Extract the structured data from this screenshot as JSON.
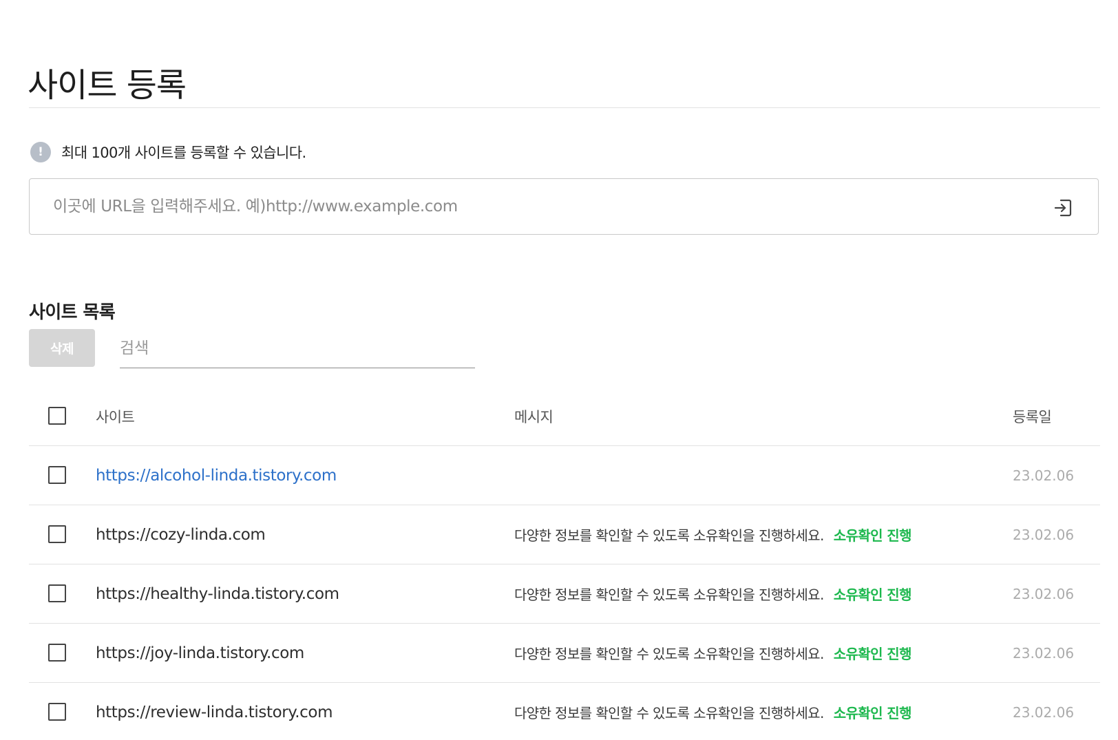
{
  "page": {
    "title": "사이트 등록"
  },
  "notice": {
    "icon": "exclamation-circle-icon",
    "icon_glyph": "!",
    "text": "최대 100개 사이트를 등록할 수 있습니다."
  },
  "url_input": {
    "placeholder": "이곳에 URL을 입력해주세요. 예)http://www.example.com",
    "value": "",
    "submit_icon": "enter-arrow-icon"
  },
  "site_list": {
    "title": "사이트 목록",
    "delete_label": "삭제",
    "search_placeholder": "검색",
    "columns": {
      "site": "사이트",
      "message": "메시지",
      "date": "등록일"
    },
    "rows": [
      {
        "site": "https://alcohol-linda.tistory.com",
        "site_is_link": true,
        "message": "",
        "action": "",
        "date": "23.02.06"
      },
      {
        "site": "https://cozy-linda.com",
        "site_is_link": false,
        "message": "다양한 정보를 확인할 수 있도록 소유확인을 진행하세요.",
        "action": "소유확인 진행",
        "date": "23.02.06"
      },
      {
        "site": "https://healthy-linda.tistory.com",
        "site_is_link": false,
        "message": "다양한 정보를 확인할 수 있도록 소유확인을 진행하세요.",
        "action": "소유확인 진행",
        "date": "23.02.06"
      },
      {
        "site": "https://joy-linda.tistory.com",
        "site_is_link": false,
        "message": "다양한 정보를 확인할 수 있도록 소유확인을 진행하세요.",
        "action": "소유확인 진행",
        "date": "23.02.06"
      },
      {
        "site": "https://review-linda.tistory.com",
        "site_is_link": false,
        "message": "다양한 정보를 확인할 수 있도록 소유확인을 진행하세요.",
        "action": "소유확인 진행",
        "date": "23.02.06"
      }
    ]
  },
  "colors": {
    "link": "#2c70c9",
    "verify": "#1db84e",
    "date": "#ababab",
    "delete_button_bg": "#d6d6d6",
    "notice_icon_bg": "#b7bec8"
  }
}
